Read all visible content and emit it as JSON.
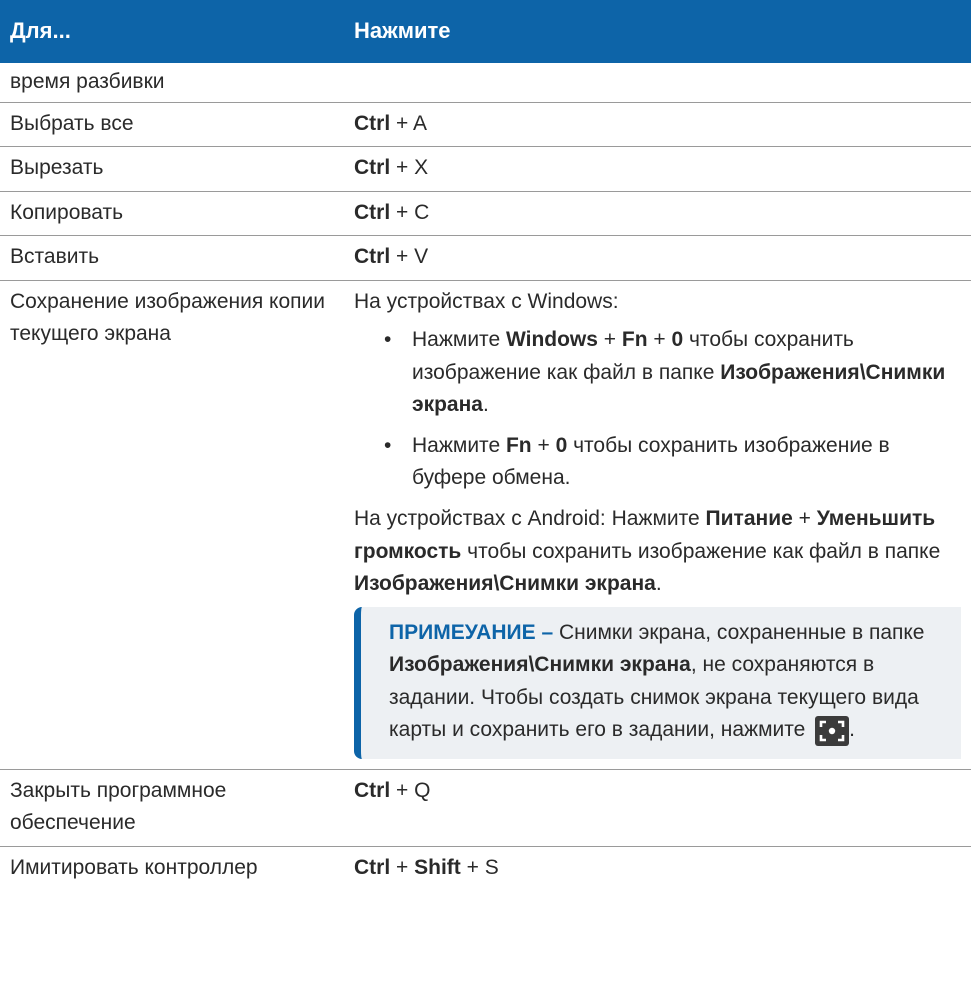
{
  "header": {
    "col1": "Для...",
    "col2": "Нажмите"
  },
  "rows": {
    "r0": {
      "label": "время разбивки"
    },
    "r1": {
      "label": "Выбрать все",
      "k1": "Ctrl",
      "plus1": " + ",
      "k2": "A"
    },
    "r2": {
      "label": "Вырезать",
      "k1": "Ctrl",
      "plus1": " + ",
      "k2": "X"
    },
    "r3": {
      "label": "Копировать",
      "k1": "Ctrl",
      "plus1": " + ",
      "k2": "C"
    },
    "r4": {
      "label": "Вставить",
      "k1": "Ctrl",
      "plus1": " + ",
      "k2": "V"
    },
    "r5": {
      "label": "Сохранение изображения копии текущего экрана",
      "windows_intro": "На устройствах с Windows:",
      "bullet_char": "•",
      "b1": {
        "pre": "Нажмите ",
        "k1": "Windows",
        "p1": " + ",
        "k2": "Fn",
        "p2": " + ",
        "k3": "0",
        "mid": " чтобы сохранить изображение как файл в папке ",
        "path": "Изображения\\Снимки экрана",
        "end": "."
      },
      "b2": {
        "pre": "Нажмите ",
        "k1": "Fn",
        "p1": " + ",
        "k2": "0",
        "end": " чтобы сохранить изображение в буфере обмена."
      },
      "android": {
        "pre": "На устройствах с Android: Нажмите ",
        "k1": "Питание",
        "p1": " + ",
        "k2": "Уменьшить громкость",
        "mid": " чтобы сохранить изображение как файл в папке ",
        "path": "Изображения\\Снимки экрана",
        "end": "."
      },
      "note": {
        "label": "ПРИМЕУАНИЕ – ",
        "t1": "Снимки экрана, сохраненные в папке ",
        "path": "Изображения\\Снимки экрана",
        "t2": ", не сохраняются в задании. Чтобы создать снимок экрана текущего вида карты и сохранить его в задании, нажмите ",
        "icon": "screenshot-icon",
        "end": "."
      }
    },
    "r6": {
      "label": "Закрыть программное обеспечение",
      "k1": "Ctrl",
      "plus1": " + ",
      "k2": "Q"
    },
    "r7": {
      "label": "Имитировать контроллер",
      "k1": "Ctrl",
      "plus1": " + ",
      "k2": "Shift",
      "plus2": " + ",
      "k3": "S"
    }
  },
  "colors": {
    "header_bg": "#0d64a8",
    "note_bg": "#edf0f3",
    "note_accent": "#0d64a8"
  }
}
